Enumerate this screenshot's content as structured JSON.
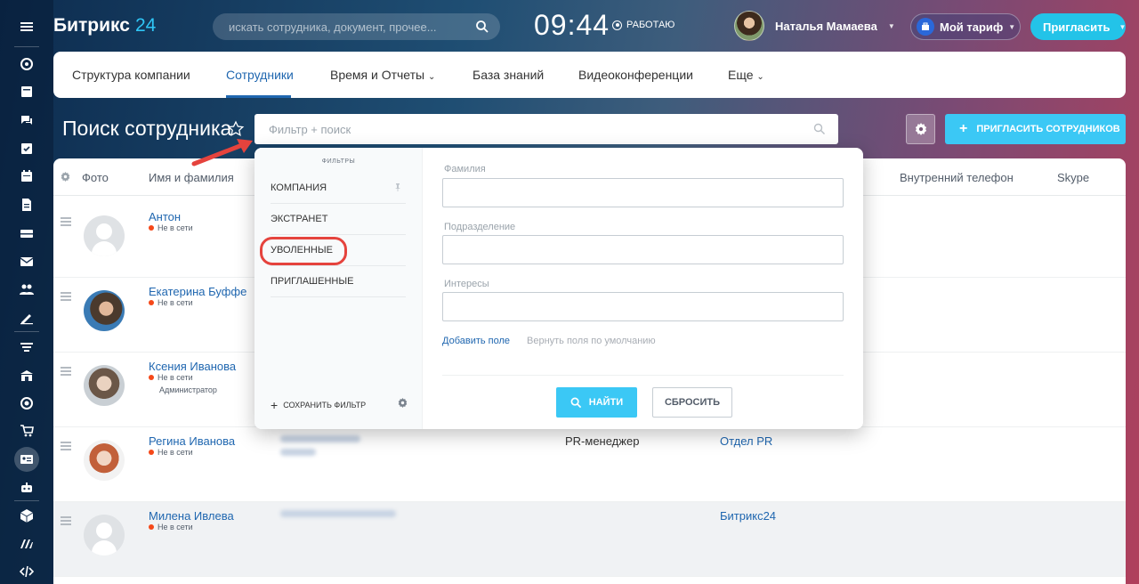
{
  "header": {
    "logo_text": "Битрикс",
    "logo_number": "24",
    "search_placeholder": "искать сотрудника, документ, прочее...",
    "clock": "09:44",
    "work_status": "РАБОТАЮ",
    "user_name": "Наталья Мамаева",
    "tariff_label": "Мой тариф",
    "invite_label": "Пригласить"
  },
  "menu": {
    "items": [
      "Структура компании",
      "Сотрудники",
      "Время и Отчеты",
      "База знаний",
      "Видеоконференции",
      "Еще"
    ],
    "active": "Сотрудники"
  },
  "page": {
    "title": "Поиск сотрудника",
    "filter_placeholder": "Фильтр + поиск",
    "invite_employees_label": "ПРИГЛАСИТЬ СОТРУДНИКОВ"
  },
  "table": {
    "columns": [
      "Фото",
      "Имя и фамилия",
      "Внутренний телефон",
      "Skype"
    ],
    "rows": [
      {
        "name": "Антон",
        "status": "Не в сети",
        "role": "",
        "position": "",
        "department": ""
      },
      {
        "name": "Екатерина Буффе",
        "status": "Не в сети",
        "role": "",
        "position": "",
        "department": ""
      },
      {
        "name": "Ксения Иванова",
        "status": "Не в сети",
        "role": "Администратор",
        "position": "",
        "department": ""
      },
      {
        "name": "Регина Иванова",
        "status": "Не в сети",
        "role": "",
        "position": "PR-менеджер",
        "department": "Отдел PR"
      },
      {
        "name": "Милена Ивлева",
        "status": "Не в сети",
        "role": "",
        "position": "",
        "department": "Битрикс24"
      }
    ]
  },
  "filter_popup": {
    "section_label": "ФИЛЬТРЫ",
    "filters": [
      "КОМПАНИЯ",
      "ЭКСТРАНЕТ",
      "УВОЛЕННЫЕ",
      "ПРИГЛАШЕННЫЕ"
    ],
    "highlighted": "УВОЛЕННЫЕ",
    "save_filter_label": "СОХРАНИТЬ ФИЛЬТР",
    "fields": [
      "Фамилия",
      "Подразделение",
      "Интересы"
    ],
    "add_field_label": "Добавить поле",
    "reset_fields_label": "Вернуть поля по умолчанию",
    "find_label": "НАЙТИ",
    "reset_label": "СБРОСИТЬ"
  },
  "colors": {
    "accent": "#3bc8f5",
    "link": "#2067b0",
    "offline": "#f54819",
    "highlight": "#e5433d"
  }
}
